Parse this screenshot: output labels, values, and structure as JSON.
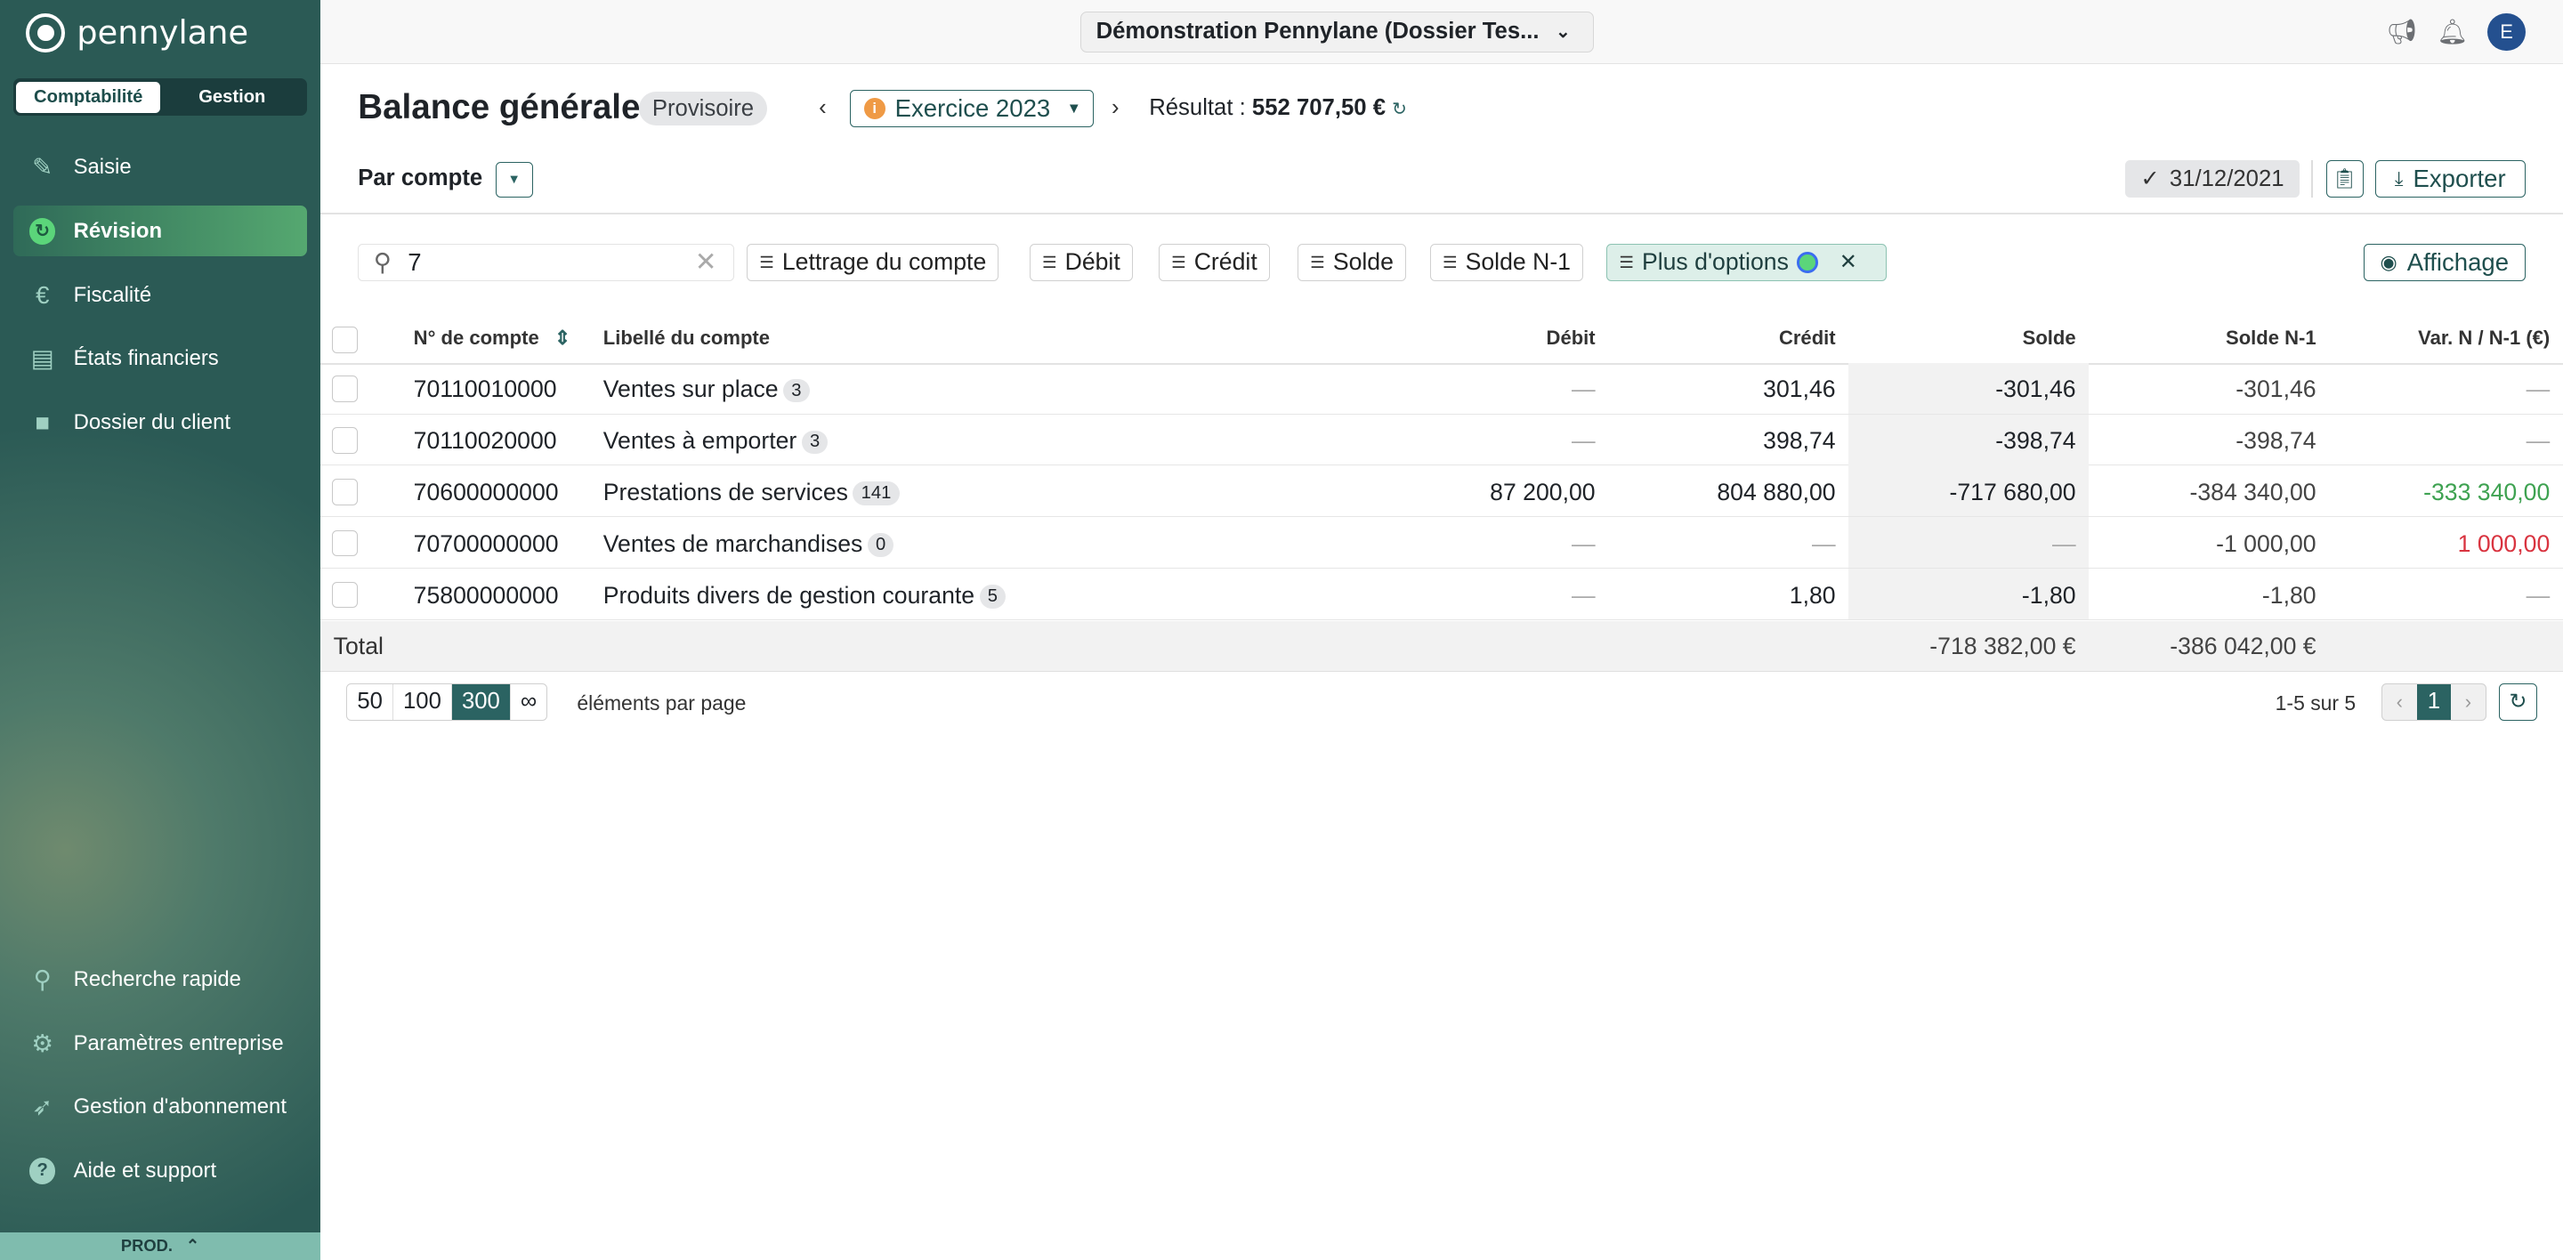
{
  "app": {
    "brand": "pennylane",
    "user_initial": "E",
    "env": "PROD."
  },
  "sidebar": {
    "segments": [
      "Comptabilité",
      "Gestion"
    ],
    "items": [
      {
        "label": "Saisie",
        "icon": "pen-icon"
      },
      {
        "label": "Révision",
        "icon": "refresh-icon",
        "active": true
      },
      {
        "label": "Fiscalité",
        "icon": "euro-icon"
      },
      {
        "label": "États financiers",
        "icon": "book-icon"
      },
      {
        "label": "Dossier du client",
        "icon": "folder-icon"
      }
    ],
    "bottom": [
      {
        "label": "Recherche rapide",
        "icon": "sparkle-search-icon"
      },
      {
        "label": "Paramètres entreprise",
        "icon": "gear-icon"
      },
      {
        "label": "Gestion d'abonnement",
        "icon": "rocket-icon"
      },
      {
        "label": "Aide et support",
        "icon": "help-icon"
      }
    ]
  },
  "topbar": {
    "dossier": "Démonstration Pennylane (Dossier Tes..."
  },
  "header": {
    "title": "Balance générale",
    "status": "Provisoire",
    "exercice": "Exercice 2023",
    "resultat_label": "Résultat :",
    "resultat_value": "552 707,50 €",
    "group_by": "Par compte",
    "date": "31/12/2021",
    "export": "Exporter"
  },
  "filters": {
    "search_value": "7",
    "chips": [
      "Lettrage du compte",
      "Débit",
      "Crédit",
      "Solde",
      "Solde N-1",
      "Plus d'options"
    ],
    "display": "Affichage"
  },
  "table": {
    "columns": [
      "N° de compte",
      "Libellé du compte",
      "Débit",
      "Crédit",
      "Solde",
      "Solde N-1",
      "Var. N / N-1 (€)"
    ],
    "rows": [
      {
        "num": "70110010000",
        "label": "Ventes sur place",
        "count": "3",
        "debit": "—",
        "credit": "301,46",
        "solde": "-301,46",
        "solde_n1": "-301,46",
        "var": "—",
        "var_color": ""
      },
      {
        "num": "70110020000",
        "label": "Ventes à emporter",
        "count": "3",
        "debit": "—",
        "credit": "398,74",
        "solde": "-398,74",
        "solde_n1": "-398,74",
        "var": "—",
        "var_color": ""
      },
      {
        "num": "70600000000",
        "label": "Prestations de services",
        "count": "141",
        "debit": "87 200,00",
        "credit": "804 880,00",
        "solde": "-717 680,00",
        "solde_n1": "-384 340,00",
        "var": "-333 340,00",
        "var_color": "green"
      },
      {
        "num": "70700000000",
        "label": "Ventes de marchandises",
        "count": "0",
        "debit": "—",
        "credit": "—",
        "solde": "—",
        "solde_n1": "-1 000,00",
        "var": "1 000,00",
        "var_color": "red"
      },
      {
        "num": "75800000000",
        "label": "Produits divers de gestion courante",
        "count": "5",
        "debit": "—",
        "credit": "1,80",
        "solde": "-1,80",
        "solde_n1": "-1,80",
        "var": "—",
        "var_color": ""
      }
    ],
    "total": {
      "label": "Total",
      "solde": "-718 382,00 €",
      "solde_n1": "-386 042,00 €"
    }
  },
  "pagination": {
    "sizes": [
      "50",
      "100",
      "300",
      "∞"
    ],
    "selected": "300",
    "per_page_label": "éléments par page",
    "range": "1-5 sur 5",
    "page": "1"
  }
}
